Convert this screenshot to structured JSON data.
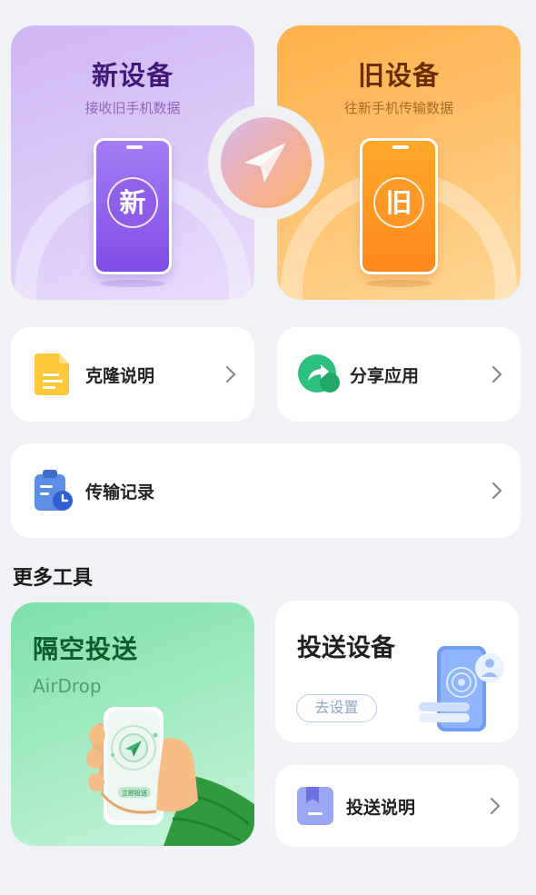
{
  "new_device": {
    "title": "新设备",
    "subtitle": "接收旧手机数据",
    "badge": "新"
  },
  "old_device": {
    "title": "旧设备",
    "subtitle": "往新手机传输数据",
    "badge": "旧"
  },
  "clone_guide": {
    "label": "克隆说明"
  },
  "share_app": {
    "label": "分享应用"
  },
  "transfer_history": {
    "label": "传输记录"
  },
  "more_tools": {
    "title": "更多工具"
  },
  "airdrop": {
    "title": "隔空投送",
    "subtitle": "AirDrop",
    "phone_button": "立即投送"
  },
  "cast_device": {
    "title": "投送设备",
    "button": "去设置"
  },
  "cast_guide": {
    "label": "投送说明"
  },
  "colors": {
    "new_accent": "#8a5cf0",
    "old_accent": "#ff9a28",
    "airdrop_accent": "#2fbf71",
    "background": "#f0f2f5"
  }
}
